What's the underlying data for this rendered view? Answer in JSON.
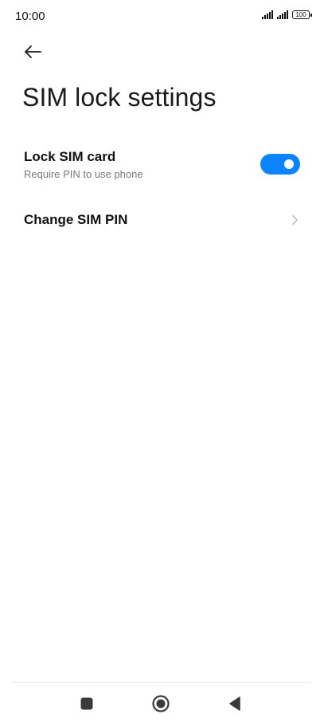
{
  "status_bar": {
    "time": "10:00",
    "battery": "100"
  },
  "header": {
    "title": "SIM lock settings"
  },
  "settings": {
    "lock_sim": {
      "title": "Lock SIM card",
      "subtitle": "Require PIN to use phone",
      "enabled": true
    },
    "change_pin": {
      "title": "Change SIM PIN"
    }
  },
  "colors": {
    "accent": "#0d84ff",
    "subtitle": "#7a7a7a"
  },
  "icons": {
    "back": "arrow-left-icon",
    "chevron": "chevron-right-icon",
    "nav_recents": "square-icon",
    "nav_home": "circle-icon",
    "nav_back": "triangle-left-icon"
  }
}
